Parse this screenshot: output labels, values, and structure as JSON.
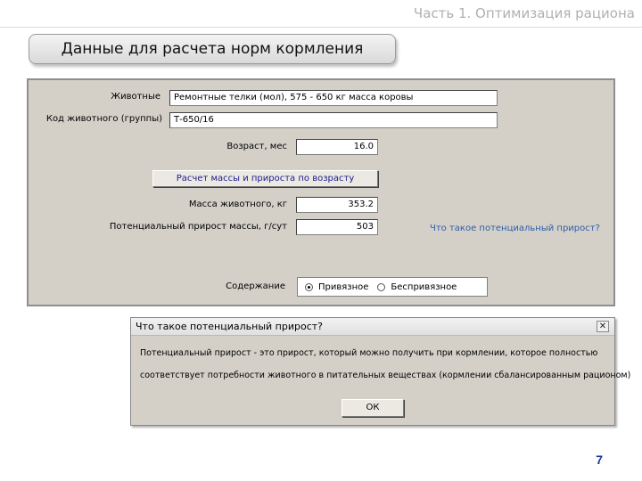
{
  "header": {
    "section_title": "Часть 1. Оптимизация рациона"
  },
  "title_box": {
    "text": "Данные для расчета норм кормления"
  },
  "form": {
    "animals": {
      "label": "Животные",
      "value": "Ремонтные телки (мол), 575 - 650 кг масса коровы"
    },
    "code": {
      "label": "Код животного (группы)",
      "value": "Т-650/16"
    },
    "age": {
      "label": "Возраст, мес",
      "value": "16.0"
    },
    "calc_button": "Расчет массы и прироста по возрасту",
    "weight": {
      "label": "Масса животного, кг",
      "value": "353.2"
    },
    "gain": {
      "label": "Потенциальный прирост массы, г/сут",
      "value": "503"
    },
    "help_link": "Что такое потенциальный прирост?",
    "housing": {
      "label": "Содержание",
      "options": [
        {
          "label": "Привязное",
          "selected": true
        },
        {
          "label": "Беспривязное",
          "selected": false
        }
      ]
    }
  },
  "dialog": {
    "title": "Что такое потенциальный прирост?",
    "close_symbol": "✕",
    "line1": "Потенциальный прирост - это прирост, который можно получить при кормлении, которое полностью",
    "line2": "соответствует потребности животного в питательных веществах (кормлении сбалансированным рационом)",
    "ok_label": "ОК"
  },
  "page_number": "7"
}
